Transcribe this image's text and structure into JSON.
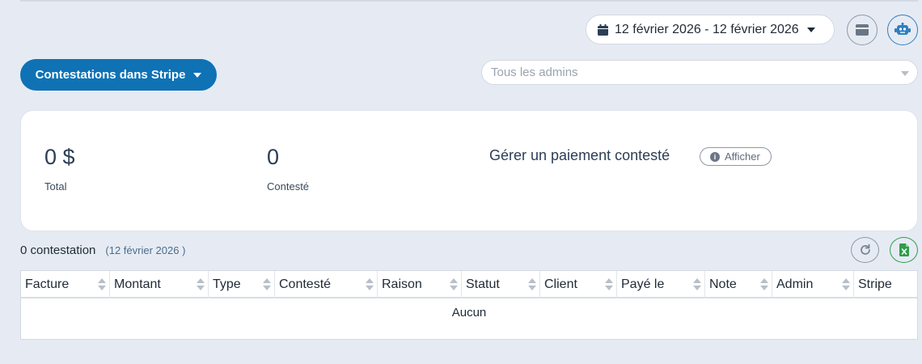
{
  "header": {
    "date_range": "12 février 2026 - 12 février 2026",
    "date_icon": "calendar-icon",
    "card_button_icon": "card-icon",
    "robot_button_icon": "robot-icon"
  },
  "filters": {
    "source_button_label": "Contestations dans Stripe",
    "admin_placeholder": "Tous les admins"
  },
  "stats": {
    "total_value": "0 $",
    "total_label": "Total",
    "disputed_value": "0",
    "disputed_label": "Contesté",
    "manage_title": "Gérer un paiement contesté",
    "show_button": "Afficher"
  },
  "list": {
    "count_text": "0 contestation",
    "date_text": "(12 février 2026 )",
    "refresh_icon": "refresh-icon",
    "excel_icon": "excel-icon"
  },
  "table": {
    "columns": [
      "Facture",
      "Montant",
      "Type",
      "Contesté",
      "Raison",
      "Statut",
      "Client",
      "Payé le",
      "Note",
      "Admin",
      "Stripe"
    ],
    "empty_text": "Aucun"
  },
  "colors": {
    "primary": "#0f72b5",
    "background": "#e6ebf3",
    "excel_green": "#2e9d4a",
    "robot_blue": "#2f7fc1"
  }
}
